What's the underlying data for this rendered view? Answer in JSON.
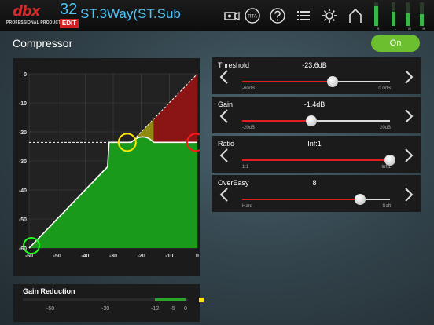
{
  "header": {
    "logo_text": "dbx",
    "logo_sub": "PROFESSIONAL PRODUCTS",
    "preset_number": "32",
    "edit_badge": "EDIT",
    "preset_name": "ST.3Way(ST.Sub",
    "icons": [
      "wizard-icon",
      "rta-icon",
      "help-icon",
      "list-icon",
      "settings-icon",
      "home-icon"
    ],
    "rta_label": "RTA",
    "meters": [
      {
        "label": "H",
        "level": 0.85
      },
      {
        "label": "L",
        "level": 0.6
      },
      {
        "label": "M",
        "level": 0.55
      },
      {
        "label": "H",
        "level": 0.5
      }
    ]
  },
  "page": {
    "title": "Compressor",
    "on_label": "On",
    "accent": "#6cbf2f"
  },
  "graph": {
    "y_ticks": [
      "0",
      "-10",
      "-20",
      "-30",
      "-40",
      "-50",
      "-60"
    ],
    "x_ticks": [
      "-60",
      "-50",
      "-40",
      "-30",
      "-20",
      "-10",
      "0"
    ],
    "threshold_db": -23.6,
    "colors": {
      "below": "#1a9a1a",
      "knee": "#8f8a10",
      "above": "#8b1414"
    }
  },
  "gain_reduction": {
    "title": "Gain Reduction",
    "ticks": [
      "-50",
      "-30",
      "-12",
      "-5",
      "0"
    ],
    "range": [
      -60,
      0
    ],
    "fill_from_db": -12,
    "fill_to_db": -0.8
  },
  "controls": [
    {
      "label": "Threshold",
      "value": "-23.6dB",
      "min": "-60dB",
      "max": "0.0dB",
      "position": 0.61
    },
    {
      "label": "Gain",
      "value": "-1.4dB",
      "min": "-20dB",
      "max": "20dB",
      "position": 0.47
    },
    {
      "label": "Ratio",
      "value": "Inf:1",
      "min": "1:1",
      "max": "Inf:1",
      "position": 1.0
    },
    {
      "label": "OverEasy",
      "value": "8",
      "min": "Hard",
      "max": "Soft",
      "position": 0.8
    }
  ]
}
